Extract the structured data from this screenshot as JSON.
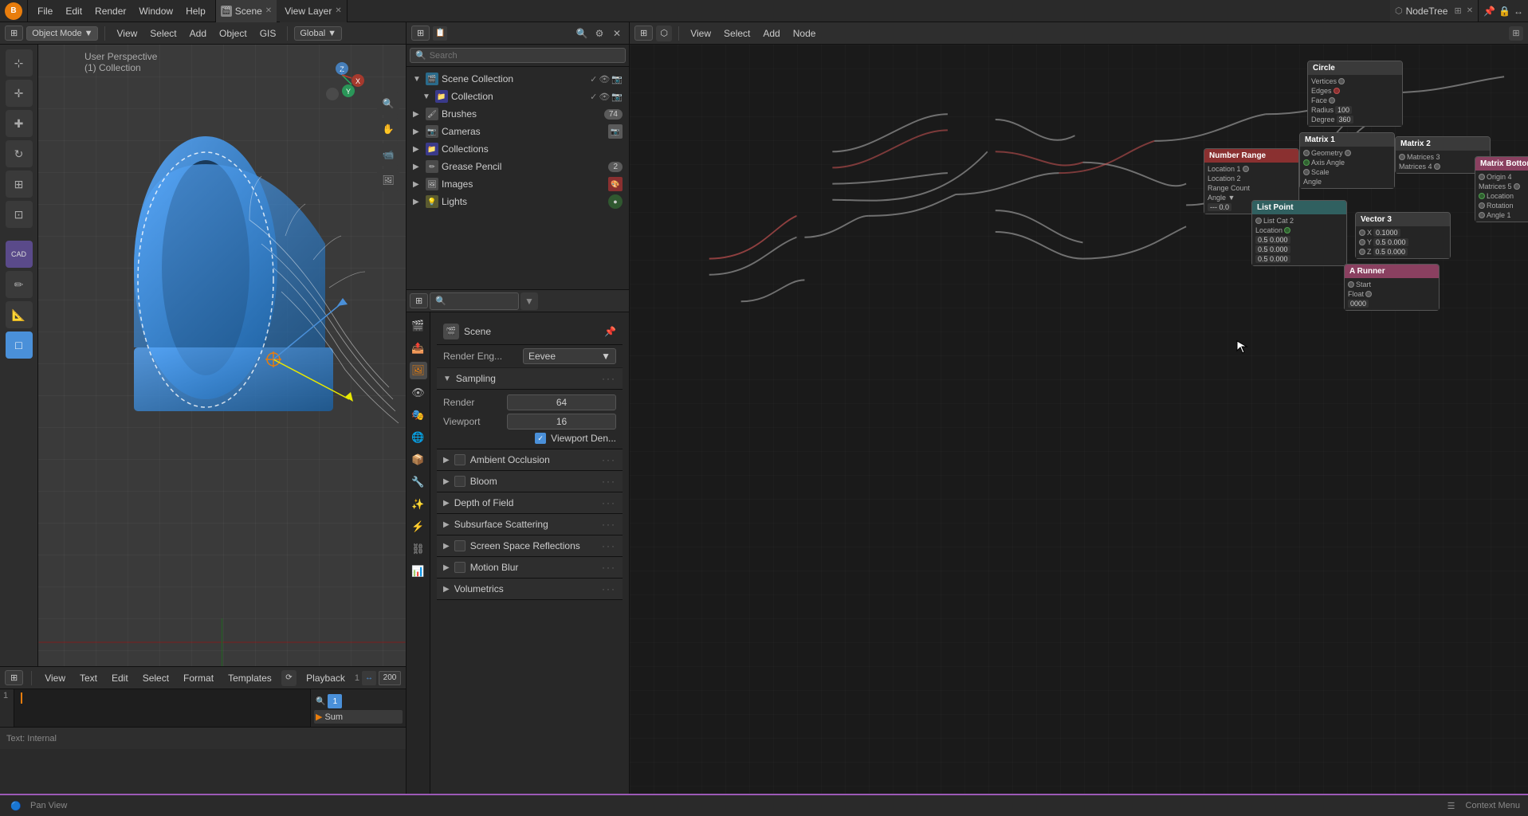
{
  "topbar": {
    "logo": "B",
    "menus": [
      "File",
      "Edit",
      "Render",
      "Window",
      "Help"
    ],
    "scene_tab": "Scene",
    "viewlayer_tab": "View Layer",
    "nodetree_tab": "NodeTree",
    "close": "✕",
    "plus": "+"
  },
  "viewport": {
    "mode": "Object Mode",
    "menu_items": [
      "View",
      "Select",
      "Add",
      "Object",
      "GIS"
    ],
    "transform": "Global",
    "info_line1": "User Perspective",
    "info_line2": "(1) Collection"
  },
  "outliner": {
    "items": [
      {
        "name": "Scene Collection",
        "type": "scene",
        "indent": 0
      },
      {
        "name": "Collection",
        "type": "collection",
        "indent": 1
      }
    ],
    "sub_items": [
      "Brushes",
      "74",
      "Cameras",
      "Collections",
      "Grease Pencil",
      "2",
      "Images",
      "Lights"
    ]
  },
  "properties": {
    "search_placeholder": "Search",
    "scene_name": "Scene",
    "render_engine_label": "Render Eng...",
    "render_engine_value": "Eevee",
    "sections": {
      "sampling": {
        "label": "Sampling",
        "expanded": true,
        "render_label": "Render",
        "render_value": "64",
        "viewport_label": "Viewport",
        "viewport_value": "16",
        "viewport_den_label": "Viewport Den...",
        "viewport_den_checked": true
      },
      "ambient_occlusion": {
        "label": "Ambient Occlusion",
        "has_checkbox": true,
        "expanded": false
      },
      "bloom": {
        "label": "Bloom",
        "has_checkbox": true,
        "expanded": false
      },
      "depth_of_field": {
        "label": "Depth of Field",
        "has_checkbox": false,
        "expanded": false
      },
      "subsurface_scattering": {
        "label": "Subsurface Scattering",
        "has_checkbox": false,
        "expanded": false
      },
      "screen_space_reflections": {
        "label": "Screen Space Reflections",
        "has_checkbox": true,
        "expanded": false
      },
      "motion_blur": {
        "label": "Motion Blur",
        "has_checkbox": true,
        "expanded": false
      },
      "volumetrics": {
        "label": "Volumetrics",
        "has_checkbox": false,
        "expanded": false
      }
    }
  },
  "bottom_bar": {
    "view_label": "View",
    "text_label": "Text",
    "edit_label": "Edit",
    "select_label": "Select",
    "format_label": "Format",
    "templates_label": "Templates",
    "playback_label": "Playback",
    "frame_current": "1",
    "frame_end": "200",
    "summary": "Sum",
    "pan_view": "Pan View",
    "context_menu": "Context Menu",
    "text_internal": "Text: Internal"
  },
  "node_editor": {
    "menu_items": [
      "View",
      "Select",
      "Add",
      "Node"
    ],
    "title": "NodeTree"
  },
  "colors": {
    "accent": "#e87d0d",
    "blue": "#4a90d9",
    "purple": "#9c59b6",
    "red": "#8a3030",
    "teal": "#306060",
    "bg_dark": "#1a1a1a",
    "bg_mid": "#2a2a2a",
    "bg_light": "#3a3a3a"
  }
}
